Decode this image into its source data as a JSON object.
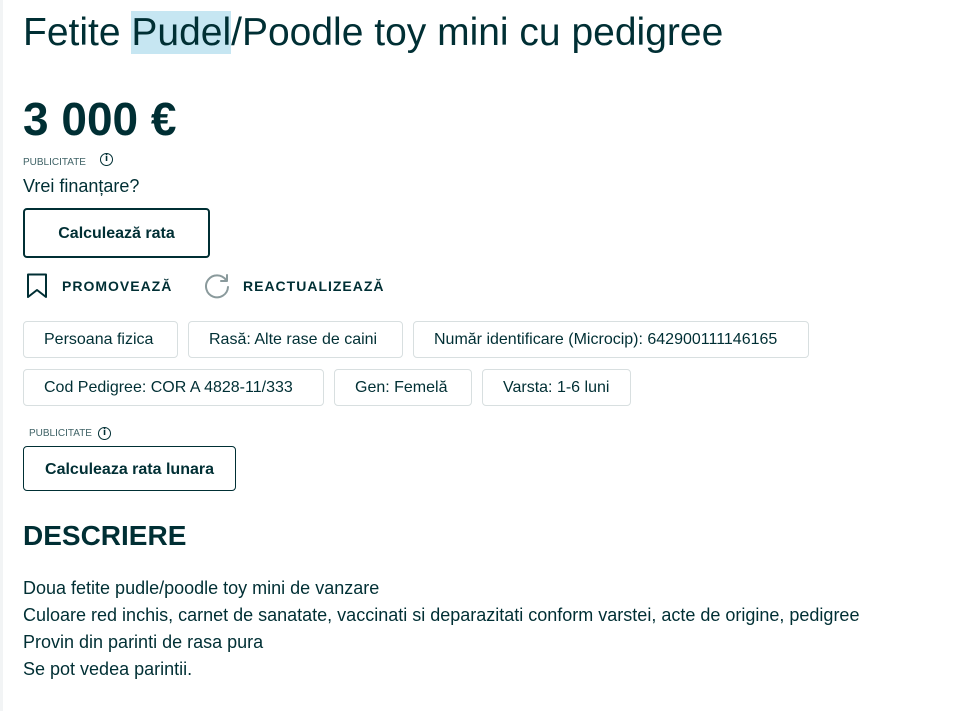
{
  "listing": {
    "title_before": "Fetite ",
    "title_highlight": "Pudel",
    "title_after": "/Poodle toy mini cu pedigree",
    "price": "3 000 €"
  },
  "finance": {
    "ad_label": "PUBLICITATE",
    "question": "Vrei finanțare?",
    "calc_button": "Calculează rata"
  },
  "actions": {
    "promote": "PROMOVEAZĂ",
    "refresh": "REACTUALIZEAZĂ"
  },
  "attributes": [
    "Persoana fizica",
    "Rasă: Alte rase de caini",
    "Număr identificare (Microcip): 642900111146165",
    "Cod Pedigree: COR A 4828-11/333",
    "Gen: Femelă",
    "Varsta: 1-6 luni"
  ],
  "monthly": {
    "ad_label": "PUBLICITATE",
    "button": "Calculeaza rata lunara"
  },
  "description": {
    "heading": "DESCRIERE",
    "lines": [
      "Doua fetite pudle/poodle toy mini de vanzare",
      "Culoare red inchis, carnet de sanatate, vaccinati si deparazitati conform varstei, acte de origine, pedigree",
      "Provin din parinti de rasa pura",
      "Se pot vedea parintii."
    ]
  },
  "icons": {
    "info": "info-icon",
    "promote": "bookmark-icon",
    "refresh": "refresh-icon"
  },
  "colors": {
    "text": "#002f34",
    "highlight": "#c6e6f2",
    "tag_border": "#d8dfe0"
  }
}
